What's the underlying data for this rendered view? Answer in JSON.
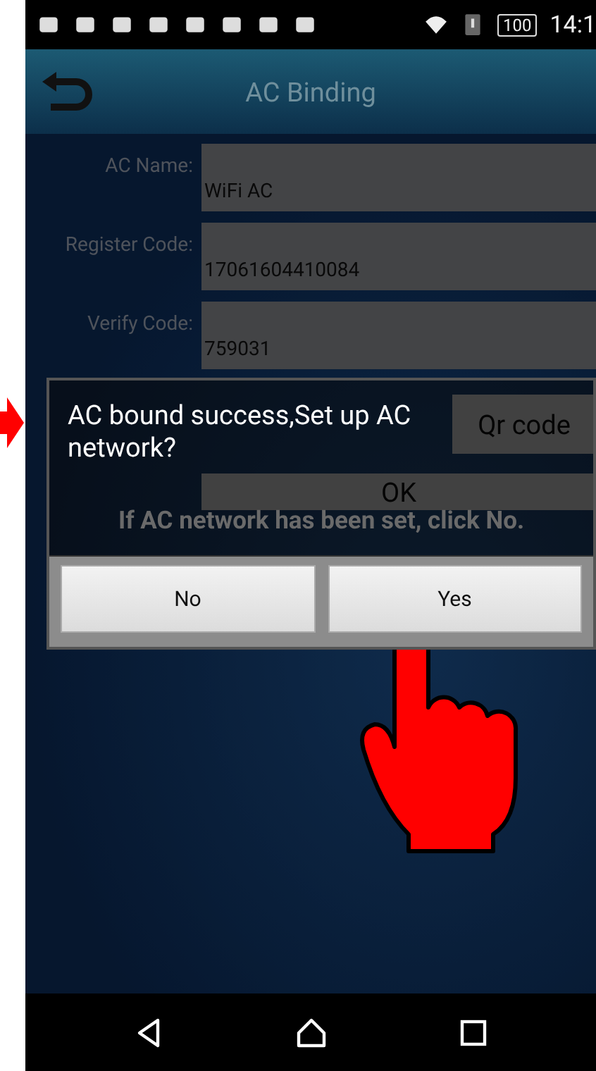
{
  "status_bar": {
    "battery": "100",
    "time": "14:1"
  },
  "title_bar": {
    "title": "AC Binding"
  },
  "form": {
    "fields": [
      {
        "label": "AC Name:",
        "value": "WiFi AC"
      },
      {
        "label": "Register Code:",
        "value": "17061604410084"
      },
      {
        "label": "Verify Code:",
        "value": "759031"
      }
    ],
    "buttons": [
      "Qr code",
      "OK"
    ]
  },
  "dialog": {
    "message": "AC bound success,Set up AC network?",
    "hint": "If AC network has been set, click No.",
    "buttons": [
      "No",
      "Yes"
    ]
  }
}
